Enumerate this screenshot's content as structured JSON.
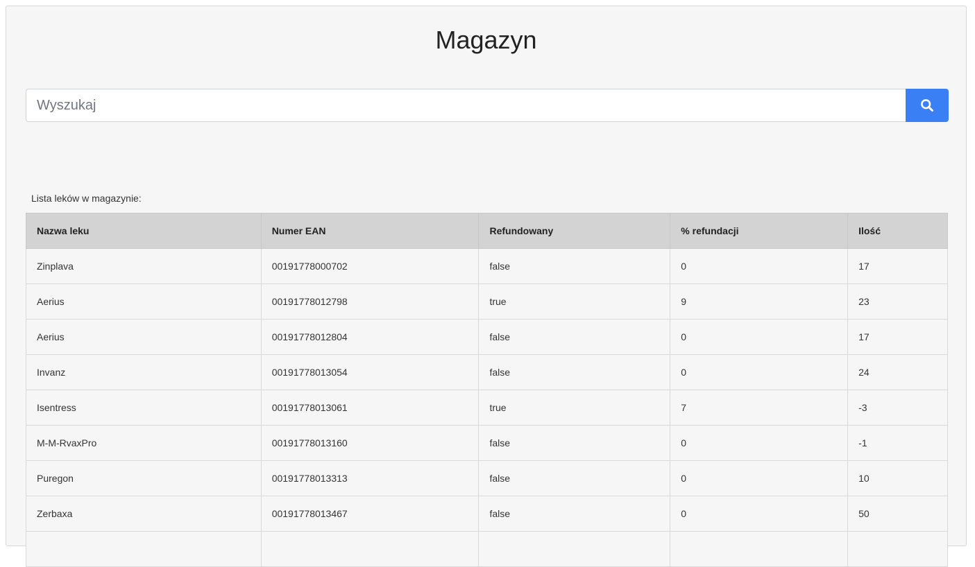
{
  "page": {
    "title": "Magazyn"
  },
  "search": {
    "placeholder": "Wyszukaj",
    "value": "",
    "button_icon": "search-icon",
    "button_color": "#3b7ff5"
  },
  "list": {
    "caption": "Lista leków w magazynie:",
    "columns": [
      "Nazwa leku",
      "Numer EAN",
      "Refundowany",
      "% refundacji",
      "Ilość"
    ],
    "rows": [
      [
        "Zinplava",
        "00191778000702",
        "false",
        "0",
        "17"
      ],
      [
        "Aerius",
        "00191778012798",
        "true",
        "9",
        "23"
      ],
      [
        "Aerius",
        "00191778012804",
        "false",
        "0",
        "17"
      ],
      [
        "Invanz",
        "00191778013054",
        "false",
        "0",
        "24"
      ],
      [
        "Isentress",
        "00191778013061",
        "true",
        "7",
        "-3"
      ],
      [
        "M-M-RvaxPro",
        "00191778013160",
        "false",
        "0",
        "-1"
      ],
      [
        "Puregon",
        "00191778013313",
        "false",
        "0",
        "10"
      ],
      [
        "Zerbaxa",
        "00191778013467",
        "false",
        "0",
        "50"
      ],
      [
        "",
        "",
        "",
        "",
        ""
      ]
    ]
  }
}
